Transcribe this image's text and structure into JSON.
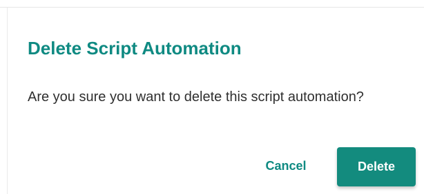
{
  "dialog": {
    "title": "Delete Script Automation",
    "message": "Are you sure you want to delete this script automation?",
    "actions": {
      "cancel_label": "Cancel",
      "delete_label": "Delete"
    }
  },
  "colors": {
    "accent": "#0f8a82",
    "delete_button_background": "#138b7e",
    "message_text": "#2f2f2f"
  }
}
